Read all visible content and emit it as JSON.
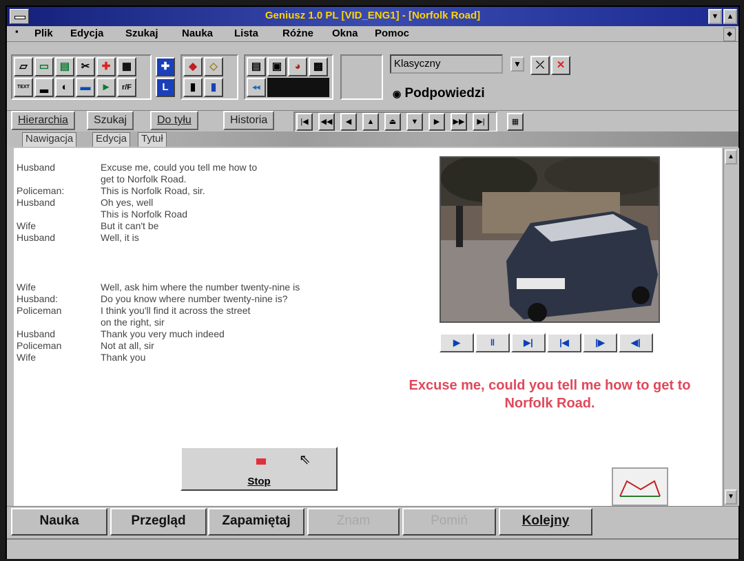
{
  "window": {
    "title": "Geniusz 1.0 PL [VID_ENG1] - [Norfolk Road]"
  },
  "menu": [
    {
      "label": "Plik"
    },
    {
      "label": "Edycja"
    },
    {
      "label": "Szukaj"
    },
    {
      "label": "Nauka"
    },
    {
      "label": "Lista"
    },
    {
      "label": "Różne"
    },
    {
      "label": "Okna"
    },
    {
      "label": "Pomoc"
    }
  ],
  "toolbar": {
    "mode_select": "Klasyczny",
    "hints_label": "Podpowiedzi",
    "text_button": "TEXT",
    "l_button": "L"
  },
  "nav_tabs": [
    "Hierarchia",
    "Szukaj",
    "Do tyłu",
    "Historia"
  ],
  "sub_tabs": [
    "Nawigacja",
    "Edycja",
    "Tytuł"
  ],
  "dialogue": [
    {
      "speaker": "Husband",
      "text": "Excuse me, could you tell me how to"
    },
    {
      "speaker": "",
      "text": "get to Norfolk Road."
    },
    {
      "speaker": "Policeman:",
      "text": "This is Norfolk Road, sir."
    },
    {
      "speaker": "Husband",
      "text": "Oh yes, well"
    },
    {
      "speaker": "",
      "text": "This is Norfolk Road"
    },
    {
      "speaker": "Wife",
      "text": "But it can't be"
    },
    {
      "speaker": "Husband",
      "text": "Well, it is"
    },
    {
      "speaker": "Wife",
      "text": "Well, ask him where the number twenty-nine is"
    },
    {
      "speaker": "Husband:",
      "text": "Do you know where number twenty-nine is?"
    },
    {
      "speaker": "Policeman",
      "text": "I think you'll find it across the street"
    },
    {
      "speaker": "",
      "text": "on the right, sir"
    },
    {
      "speaker": "Husband",
      "text": "Thank you very much indeed"
    },
    {
      "speaker": "Policeman",
      "text": "Not at all, sir"
    },
    {
      "speaker": "Wife",
      "text": "Thank you"
    }
  ],
  "caption": "Excuse me, could you tell me how to get to Norfolk Road.",
  "stop_label": "Stop",
  "bottom_buttons": [
    {
      "label": "Nauka",
      "enabled": true
    },
    {
      "label": "Przegląd",
      "enabled": true
    },
    {
      "label": "Zapamiętaj",
      "enabled": true
    },
    {
      "label": "Znam",
      "enabled": false
    },
    {
      "label": "Pomiń",
      "enabled": false
    },
    {
      "label": "Kolejny",
      "enabled": true
    }
  ],
  "colors": {
    "caption": "#e0485a",
    "title": "#ffd400",
    "titlebar": "#1c2a90"
  }
}
